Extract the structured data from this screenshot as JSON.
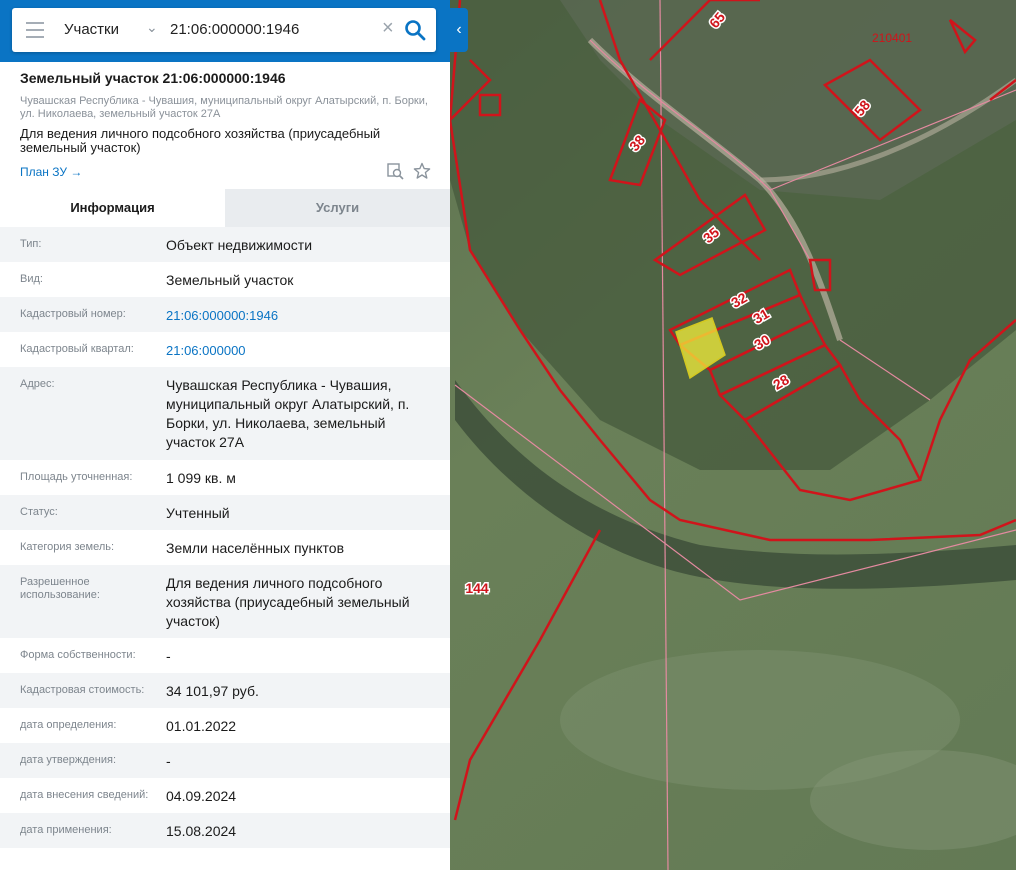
{
  "search": {
    "type_label": "Участки",
    "query": "21:06:000000:1946"
  },
  "object": {
    "title": "Земельный участок 21:06:000000:1946",
    "address": "Чувашская Республика - Чувашия, муниципальный округ Алатырский, п. Борки, ул. Николаева, земельный участок 27А",
    "use": "Для ведения личного подсобного хозяйства (приусадебный земельный участок)",
    "plan_link": "План ЗУ →"
  },
  "tabs": [
    "Информация",
    "Услуги"
  ],
  "info_rows": [
    {
      "label": "Тип:",
      "value": "Объект недвижимости"
    },
    {
      "label": "Вид:",
      "value": "Земельный участок"
    },
    {
      "label": "Кадастровый номер:",
      "value": "21:06:000000:1946"
    },
    {
      "label": "Кадастровый квартал:",
      "value": "21:06:000000"
    },
    {
      "label": "Адрес:",
      "value": "Чувашская Республика - Чувашия, муниципальный округ Алатырский, п. Борки, ул. Николаева, земельный участок 27А"
    },
    {
      "label": "Площадь уточненная:",
      "value": "1 099 кв. м"
    },
    {
      "label": "Статус:",
      "value": "Учтенный"
    },
    {
      "label": "Категория земель:",
      "value": "Земли населённых пунктов"
    },
    {
      "label": "Разрешенное использование:",
      "value": "Для ведения личного подсобного хозяйства (приусадебный земельный участок)"
    },
    {
      "label": "Форма собственности:",
      "value": "-"
    },
    {
      "label": "Кадастровая стоимость:",
      "value": "34 101,97 руб."
    },
    {
      "label": "дата определения:",
      "value": "01.01.2022"
    },
    {
      "label": "дата утверждения:",
      "value": "-"
    },
    {
      "label": "дата внесения сведений:",
      "value": "04.09.2024"
    },
    {
      "label": "дата применения:",
      "value": "15.08.2024"
    }
  ],
  "map": {
    "quarter_label": "210401",
    "parcel_labels": [
      "65",
      "58",
      "38",
      "35",
      "32",
      "31",
      "30",
      "28",
      "144"
    ]
  },
  "colors": {
    "accent": "#0a74c4",
    "parcel_border": "#d0141b",
    "selected_parcel": "#f5ef3a"
  }
}
